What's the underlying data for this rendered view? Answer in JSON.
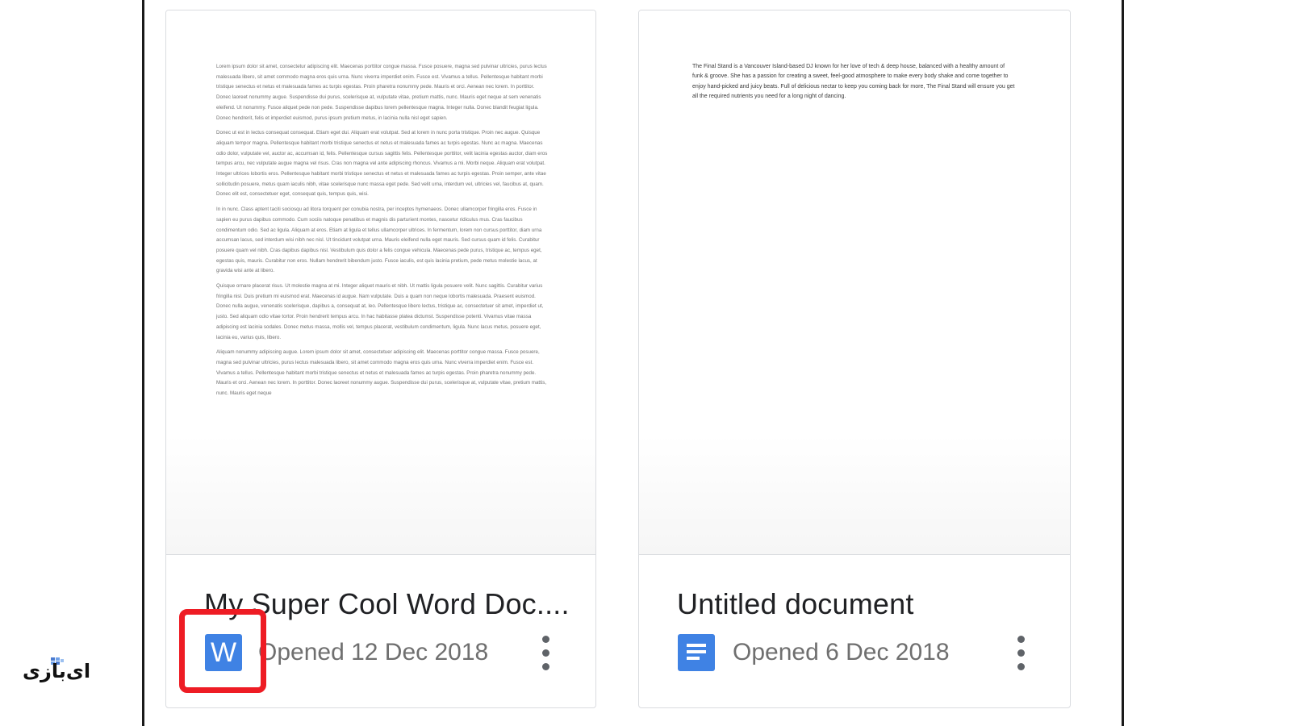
{
  "cards": [
    {
      "title": "My Super Cool Word Doc....",
      "opened": "Opened 12 Dec 2018",
      "icon_letter": "W",
      "icon": "word-icon",
      "icon_color": "#3f82e4",
      "thumb_paragraphs": [
        "Lorem ipsum dolor sit amet, consectetur adipiscing elit. Maecenas porttitor congue massa. Fusce posuere, magna sed pulvinar ultricies, purus lectus malesuada libero, sit amet commodo magna eros quis urna. Nunc viverra imperdiet enim. Fusce est. Vivamus a tellus. Pellentesque habitant morbi tristique senectus et netus et malesuada fames ac turpis egestas. Proin pharetra nonummy pede. Mauris et orci. Aenean nec lorem. In porttitor. Donec laoreet nonummy augue. Suspendisse dui purus, scelerisque at, vulputate vitae, pretium mattis, nunc. Mauris eget neque at sem venenatis eleifend. Ut nonummy. Fusce aliquet pede non pede. Suspendisse dapibus lorem pellentesque magna. Integer nulla. Donec blandit feugiat ligula. Donec hendrerit, felis et imperdiet euismod, purus ipsum pretium metus, in lacinia nulla nisl eget sapien.",
        "Donec ut est in lectus consequat consequat. Etiam eget dui. Aliquam erat volutpat. Sed at lorem in nunc porta tristique. Proin nec augue. Quisque aliquam tempor magna. Pellentesque habitant morbi tristique senectus et netus et malesuada fames ac turpis egestas. Nunc ac magna. Maecenas odio dolor, vulputate vel, auctor ac, accumsan id, felis. Pellentesque cursus sagittis felis. Pellentesque porttitor, velit lacinia egestas auctor, diam eros tempus arcu, nec vulputate augue magna vel risus. Cras non magna vel ante adipiscing rhoncus. Vivamus a mi. Morbi neque. Aliquam erat volutpat. Integer ultrices lobortis eros. Pellentesque habitant morbi tristique senectus et netus et malesuada fames ac turpis egestas. Proin semper, ante vitae sollicitudin posuere, metus quam iaculis nibh, vitae scelerisque nunc massa eget pede. Sed velit urna, interdum vel, ultricies vel, faucibus at, quam. Donec elit est, consectetuer eget, consequat quis, tempus quis, wisi.",
        "In in nunc. Class aptent taciti sociosqu ad litora torquent per conubia nostra, per inceptos hymenaeos. Donec ullamcorper fringilla eros. Fusce in sapien eu purus dapibus commodo. Cum sociis natoque penatibus et magnis dis parturient montes, nascetur ridiculus mus. Cras faucibus condimentum odio. Sed ac ligula. Aliquam at eros. Etiam at ligula et tellus ullamcorper ultrices. In fermentum, lorem non cursus porttitor, diam urna accumsan lacus, sed interdum wisi nibh nec nisl. Ut tincidunt volutpat urna. Mauris eleifend nulla eget mauris. Sed cursus quam id felis. Curabitur posuere quam vel nibh. Cras dapibus dapibus nisl. Vestibulum quis dolor a felis congue vehicula. Maecenas pede purus, tristique ac, tempus eget, egestas quis, mauris. Curabitur non eros. Nullam hendrerit bibendum justo. Fusce iaculis, est quis lacinia pretium, pede metus molestie lacus, at gravida wisi ante at libero.",
        "Quisque ornare placerat risus. Ut molestie magna at mi. Integer aliquet mauris et nibh. Ut mattis ligula posuere velit. Nunc sagittis. Curabitur varius fringilla nisl. Duis pretium mi euismod erat. Maecenas id augue. Nam vulputate. Duis a quam non neque lobortis malesuada. Praesent euismod. Donec nulla augue, venenatis scelerisque, dapibus a, consequat at, leo. Pellentesque libero lectus, tristique ac, consectetuer sit amet, imperdiet ut, justo. Sed aliquam odio vitae tortor. Proin hendrerit tempus arcu. In hac habitasse platea dictumst. Suspendisse potenti. Vivamus vitae massa adipiscing est lacinia sodales. Donec metus massa, mollis vel, tempus placerat, vestibulum condimentum, ligula. Nunc lacus metus, posuere eget, lacinia eu, varius quis, libero.",
        "Aliquam nonummy adipiscing augue. Lorem ipsum dolor sit amet, consectetuer adipiscing elit. Maecenas porttitor congue massa. Fusce posuere, magna sed pulvinar ultricies, purus lectus malesuada libero, sit amet commodo magna eros quis urna. Nunc viverra imperdiet enim. Fusce est. Vivamus a tellus. Pellentesque habitant morbi tristique senectus et netus et malesuada fames ac turpis egestas. Proin pharetra nonummy pede. Mauris et orci. Aenean nec lorem. In porttitor. Donec laoreet nonummy augue. Suspendisse dui purus, scelerisque at, vulputate vitae, pretium mattis, nunc. Mauris eget neque"
      ]
    },
    {
      "title": "Untitled document",
      "opened": "Opened 6 Dec 2018",
      "icon": "google-docs-icon",
      "icon_color": "#3f82e4",
      "thumb_text": "The Final Stand is a Vancouver Island-based DJ known for her love of tech & deep house, balanced with a healthy amount of funk & groove. She has a passion for creating a sweet, feel-good atmosphere to make every body shake and come together to enjoy hand-picked and juicy beats. Full of delicious nectar to keep you coming back for more, The Final Stand will ensure you get all the required nutrients you need for a long night of dancing."
    }
  ],
  "highlight_color": "#ee1c24",
  "watermark": {
    "text": "ای‌بازی",
    "icon": "grid-logo-icon"
  }
}
